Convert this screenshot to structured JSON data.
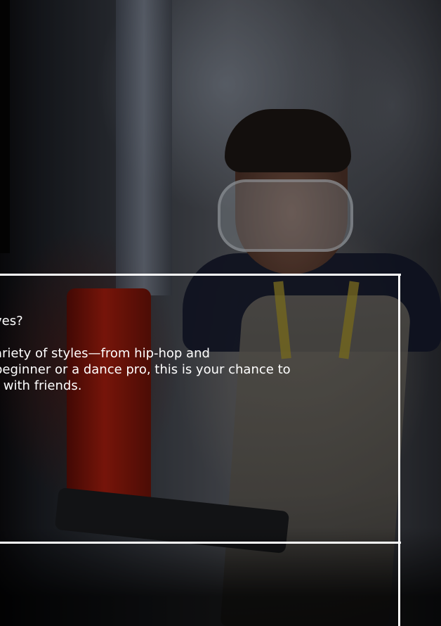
{
  "card": {
    "question": "ves?",
    "description_lines": [
      "ariety of styles—from hip-hop and",
      "beginner or a dance pro, this is your chance to",
      "t with friends."
    ]
  }
}
